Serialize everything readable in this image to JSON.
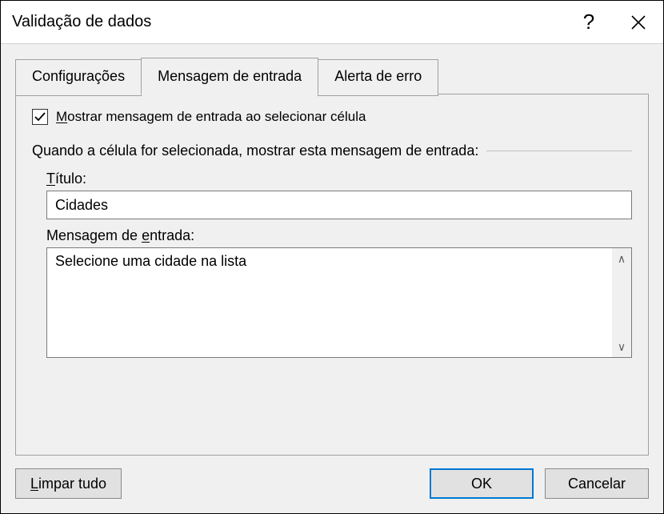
{
  "titlebar": {
    "title": "Validação de dados",
    "help_symbol": "?",
    "close_symbol": "×"
  },
  "tabs": {
    "settings": "Configurações",
    "input_message": "Mensagem de entrada",
    "error_alert": "Alerta de erro"
  },
  "panel": {
    "show_message_prefix": "M",
    "show_message_rest": "ostrar mensagem de entrada ao selecionar célula",
    "when_selected": "Quando a célula for selecionada, mostrar esta mensagem de entrada:",
    "title_label_u": "T",
    "title_label_rest": "ítulo:",
    "title_value": "Cidades",
    "message_label_pre": "Mensagem de ",
    "message_label_u": "e",
    "message_label_rest": "ntrada:",
    "message_value": "Selecione uma cidade na lista"
  },
  "buttons": {
    "clear_u": "L",
    "clear_rest": "impar tudo",
    "ok": "OK",
    "cancel": "Cancelar"
  }
}
